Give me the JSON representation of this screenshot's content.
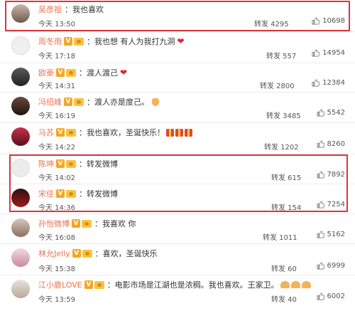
{
  "comments": [
    {
      "name": "吴彦祖",
      "text": "：我也喜欢",
      "time": "今天 13:50",
      "repost": "转发 4295",
      "likes": "10698"
    },
    {
      "name": "周冬雨",
      "text": "：我也想 有人为我打九洞",
      "time": "今天 17:18",
      "repost": "转发 557",
      "likes": "14954"
    },
    {
      "name": "欧豪",
      "text": "：渡人渡己",
      "time": "今天 14:31",
      "repost": "转发 2800",
      "likes": "12384"
    },
    {
      "name": "冯绍峰",
      "text": "：渡人亦是度己。",
      "time": "今天 16:19",
      "repost": "转发 3485",
      "likes": "5542"
    },
    {
      "name": "马苏",
      "text": "：我也喜欢，圣诞快乐！",
      "time": "今天 14:22",
      "repost": "转发 1202",
      "likes": "8260"
    },
    {
      "name": "陈坤",
      "text": "：转发微博",
      "time": "今天 14:02",
      "repost": "转发 615",
      "likes": "7892"
    },
    {
      "name": "宋佳",
      "text": "：转发微博",
      "time": "今天 14:36",
      "repost": "转发 154",
      "likes": "7254"
    },
    {
      "name": "孙怡微博",
      "text": "：我喜欢 你",
      "time": "今天 16:08",
      "repost": "转发 1011",
      "likes": "5162"
    },
    {
      "name": "林允Jelly",
      "text": "：喜欢，圣诞快乐",
      "time": "今天 15:38",
      "repost": "转发 60",
      "likes": "6999"
    },
    {
      "name": "江小鹿LOVE",
      "text": "：电影市场是江湖也是浓稠。我也喜欢。王家卫。",
      "time": "今天 13:59",
      "repost": "转发 40",
      "likes": "6002"
    }
  ],
  "colors": {
    "highlight": "#d9363e",
    "username": "#eb7350"
  }
}
